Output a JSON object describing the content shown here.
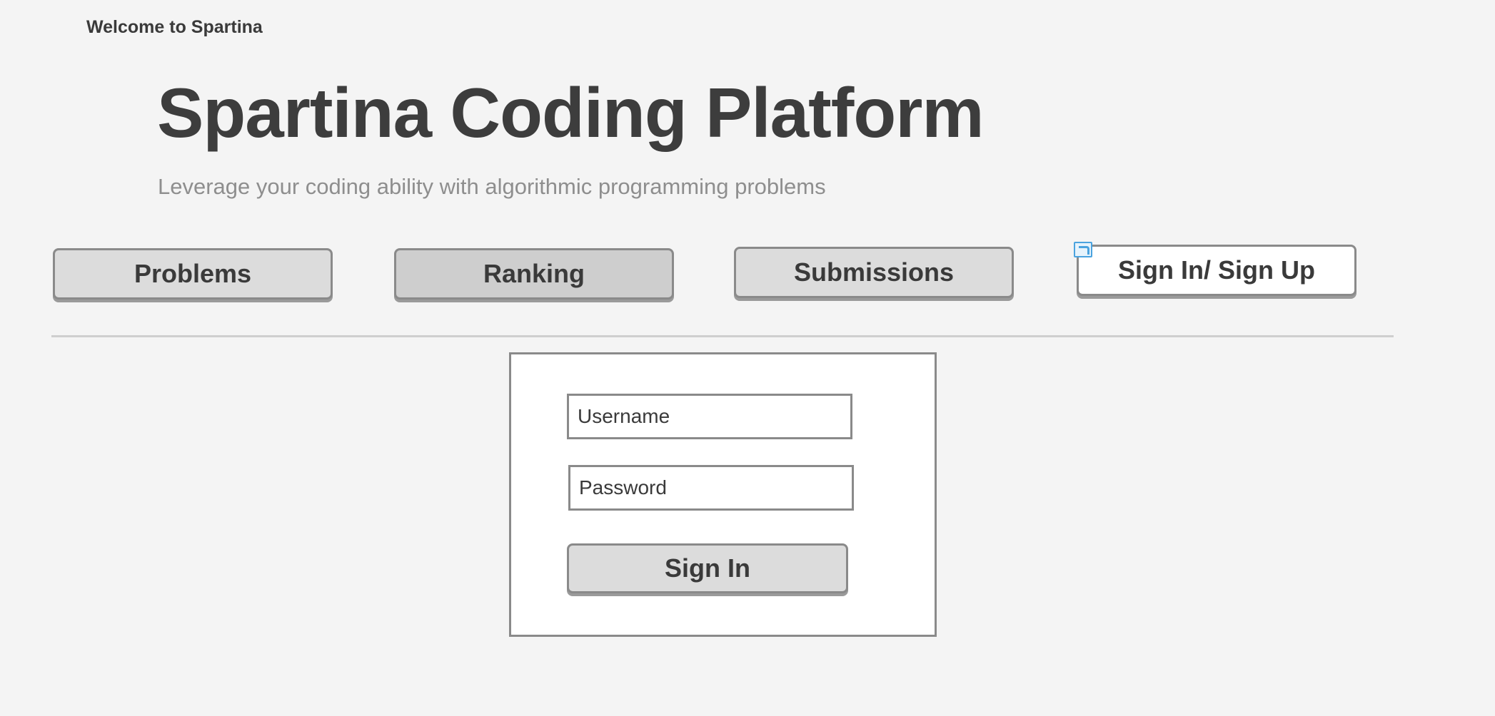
{
  "header": {
    "welcome": "Welcome to Spartina",
    "title": "Spartina Coding Platform",
    "subtitle": "Leverage your coding ability with algorithmic programming problems"
  },
  "nav": {
    "problems": "Problems",
    "ranking": "Ranking",
    "submissions": "Submissions",
    "signin_signup": "Sign In/ Sign Up",
    "link_icon": "link-icon"
  },
  "login": {
    "username_placeholder": "Username",
    "password_placeholder": "Password",
    "signin_label": "Sign In"
  },
  "colors": {
    "background": "#f4f4f4",
    "text": "#3a3a3a",
    "subtitle": "#8e8e8e",
    "border": "#8a8a8a",
    "button": "#dcdcdc",
    "link_icon": "#4aa3df"
  }
}
